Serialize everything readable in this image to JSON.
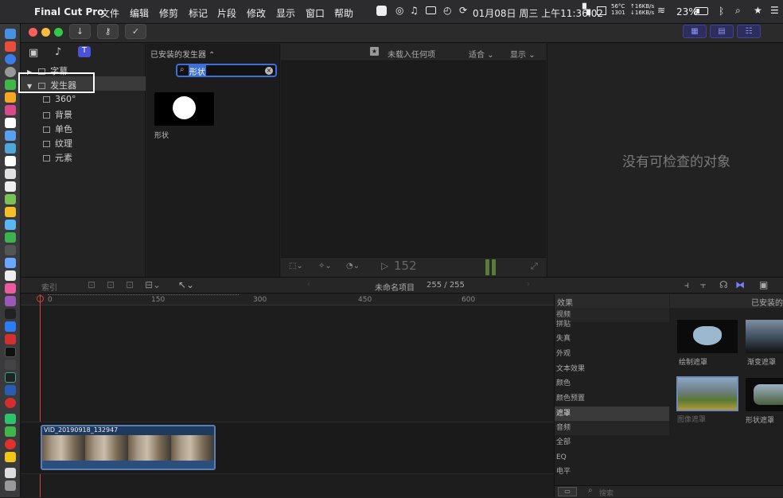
{
  "menubar": {
    "app_name": "Final Cut Pro",
    "menus": [
      "文件",
      "编辑",
      "修剪",
      "标记",
      "片段",
      "修改",
      "显示",
      "窗口",
      "帮助"
    ],
    "temp_top": "56°C",
    "temp_bottom": "1301",
    "net_up": "↑16KB/s",
    "net_down": "↓16KB/s",
    "battery": "23%",
    "datetime": "01月08日 周三 上午11:36:02"
  },
  "browser": {
    "installed_generators_label": "已安装的发生器",
    "search_value": "形状",
    "sidebar": [
      {
        "label": "字幕",
        "expanded": false
      },
      {
        "label": "发生器",
        "expanded": true
      }
    ],
    "generator_items": [
      "360°",
      "背景",
      "单色",
      "纹理",
      "元素"
    ],
    "result_label": "形状"
  },
  "viewer": {
    "status": "未载入任何项",
    "fit_label": "适合",
    "display_label": "显示",
    "frame_count": "152"
  },
  "inspector": {
    "empty_message": "没有可检查的对象"
  },
  "timeline": {
    "index_label": "索引",
    "project_name": "未命名项目",
    "position": "255 / 255",
    "ruler_marks": [
      "0",
      "150",
      "300",
      "450",
      "600"
    ],
    "clip_name": "VID_20190918_132947"
  },
  "effects": {
    "title": "效果",
    "installed_label": "已安装的",
    "categories": [
      "视频",
      "拼贴",
      "失真",
      "外观",
      "文本效果",
      "颜色",
      "颜色预置",
      "遮罩",
      "音频",
      "全部",
      "EQ",
      "电平"
    ],
    "selected": "遮罩",
    "thumbnails": [
      "绘制遮罩",
      "渐变遮罩",
      "图像遮罩",
      "形状遮罩"
    ],
    "search_placeholder": "搜索"
  },
  "colors": {
    "accent": "#6e6eff",
    "highlight_box": "#ffffff",
    "playhead": "#d0443a",
    "clip_border": "#5b7fb5"
  }
}
